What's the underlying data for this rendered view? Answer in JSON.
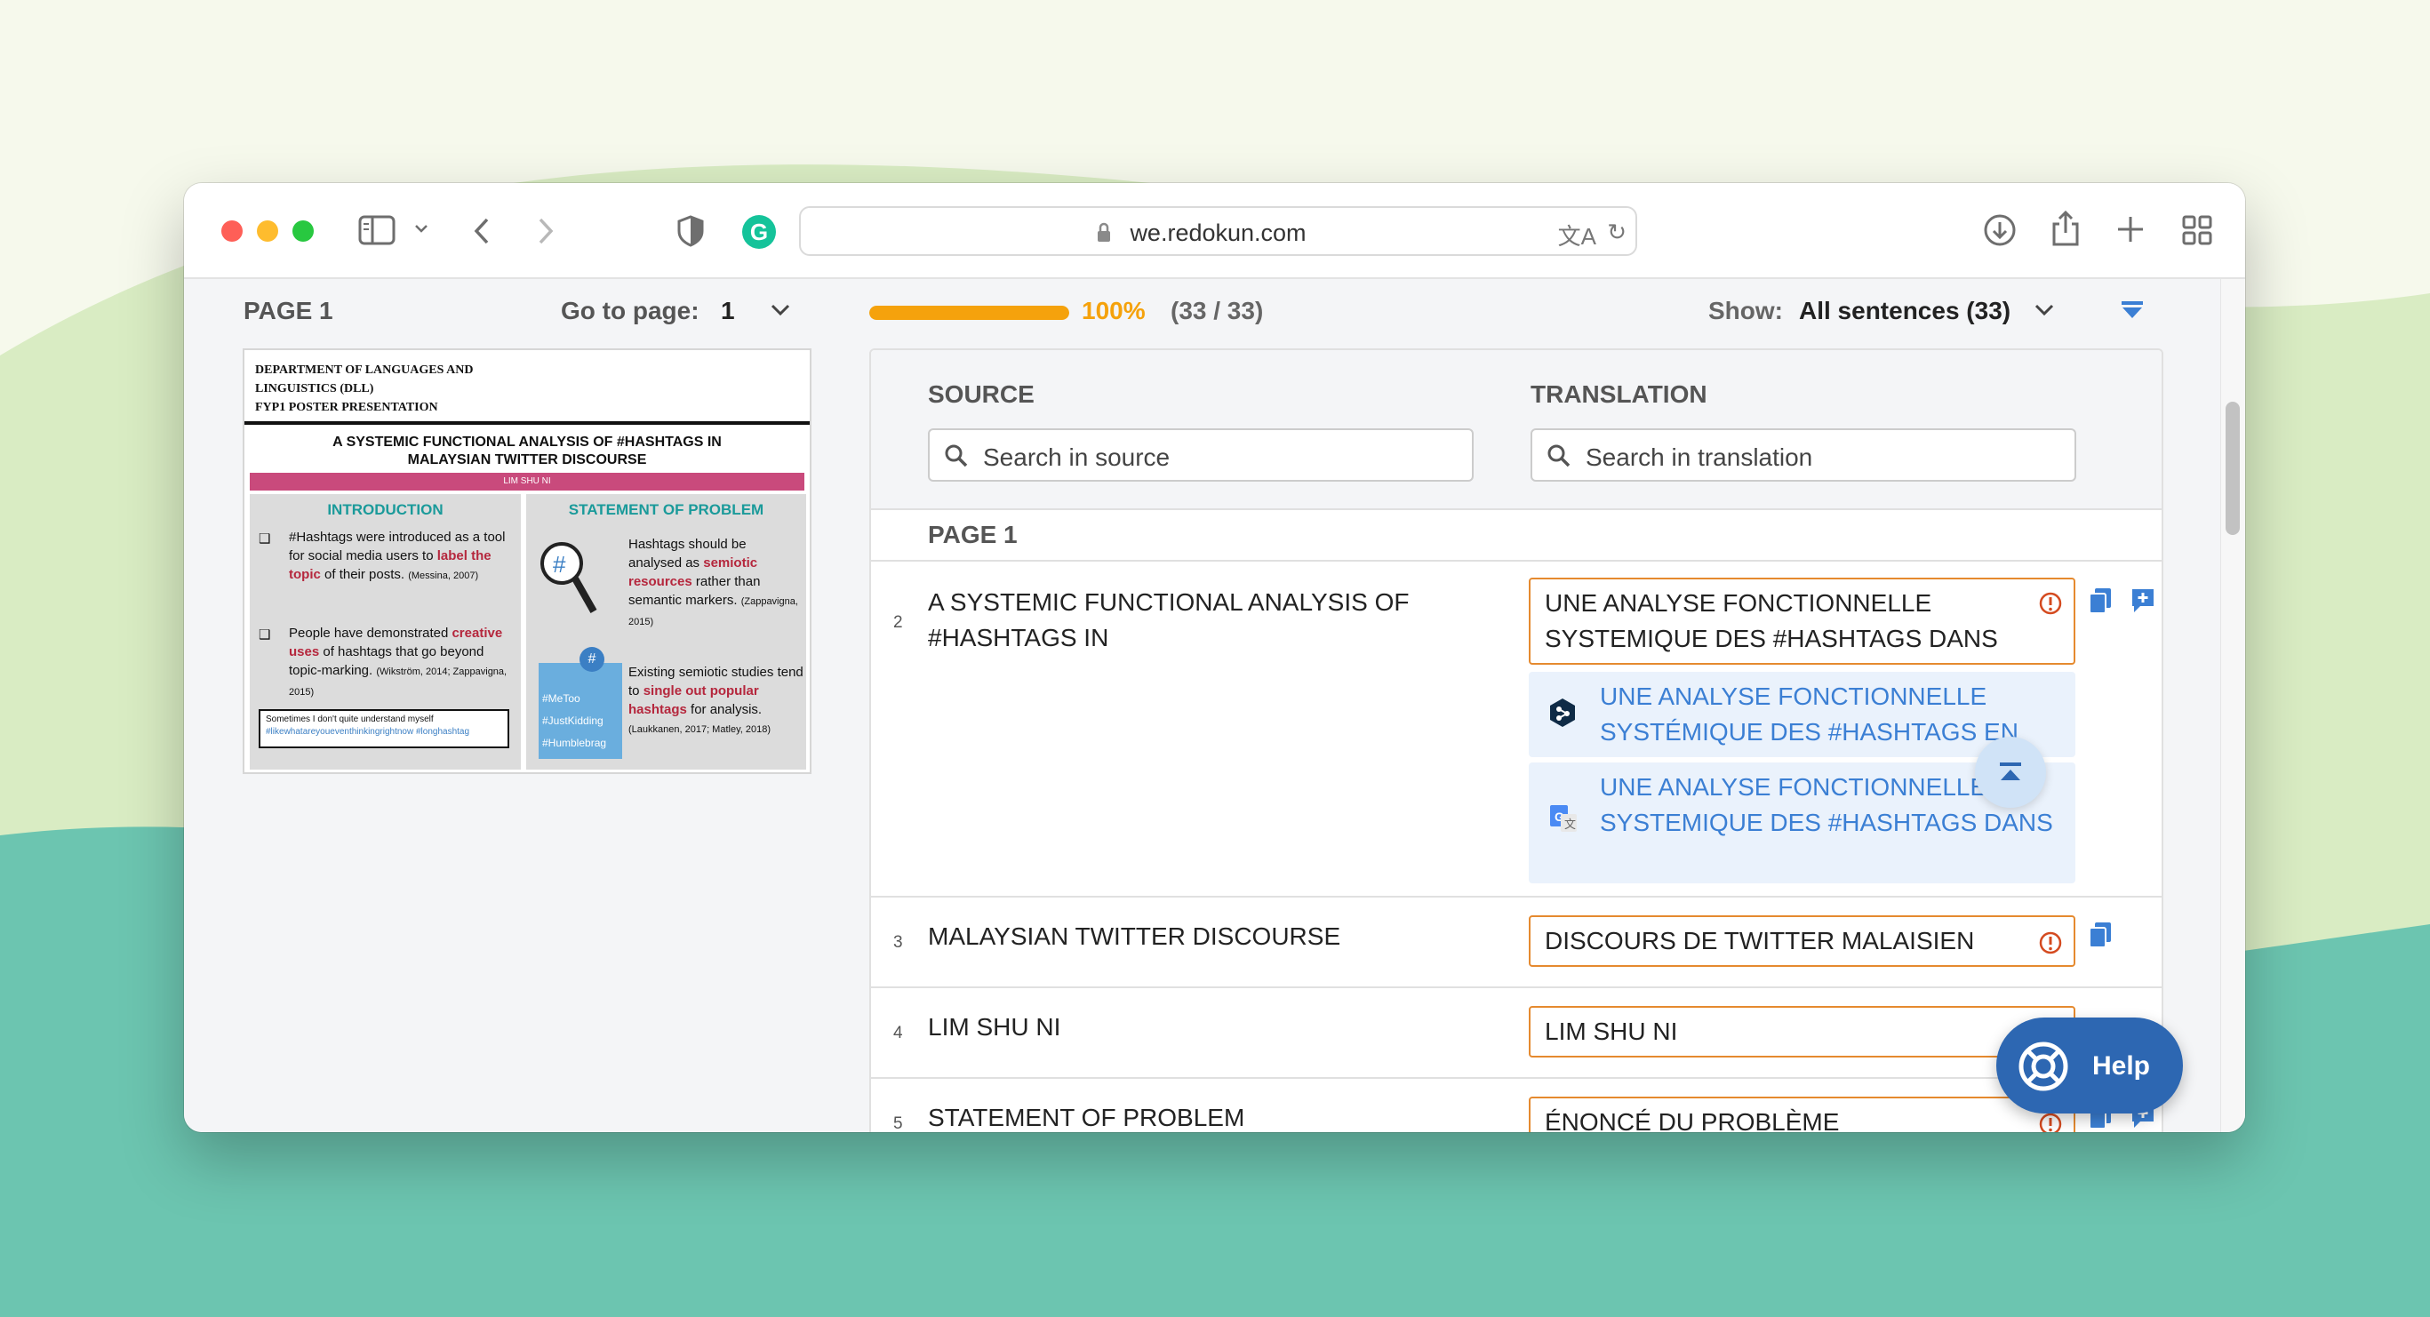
{
  "browser": {
    "url": "we.redokun.com"
  },
  "toolbar": {
    "page_label": "PAGE 1",
    "goto_label": "Go to page:",
    "goto_value": "1",
    "progress_percent": "100%",
    "progress_count": "(33 / 33)",
    "progress_fraction": 1.0,
    "show_label": "Show:",
    "show_value": "All sentences (33)"
  },
  "poster": {
    "dept_line1": "DEPARTMENT OF LANGUAGES AND",
    "dept_line2": "LINGUISTICS (DLL)",
    "dept_line3": "FYP1 POSTER PRESENTATION",
    "title_line1": "A SYSTEMIC FUNCTIONAL ANALYSIS OF #HASHTAGS IN",
    "title_line2": "MALAYSIAN TWITTER DISCOURSE",
    "author": "LIM SHU NI",
    "intro_heading": "INTRODUCTION",
    "intro_p1_a": "#Hashtags were introduced as a tool for social media users to",
    "intro_p1_hl": "label the topic",
    "intro_p1_b": "of their posts.",
    "intro_p1_cite": "(Messina, 2007)",
    "intro_p2_a": "People have demonstrated",
    "intro_p2_hl": "creative uses",
    "intro_p2_b": "of hashtags that go beyond topic-marking.",
    "intro_p2_cite": "(Wikström, 2014; Zappavigna, 2015)",
    "quote_line": "Sometimes I don't quite understand myself",
    "quote_tags": "#likewhatareyoueventhinkingrightnow #longhashtag",
    "problem_heading": "STATEMENT OF PROBLEM",
    "problem_p1_a": "Hashtags should be analysed as",
    "problem_p1_hl": "semiotic resources",
    "problem_p1_b": "rather than semantic markers.",
    "problem_p1_cite": "(Zappavigna, 2015)",
    "problem_p2_a": "Existing semiotic studies tend to",
    "problem_p2_hl": "single out popular hashtags",
    "problem_p2_b": "for analysis.",
    "problem_p2_cite": "(Laukkanen, 2017; Matley, 2018)",
    "tag1": "#MeToo",
    "tag2": "#JustKidding",
    "tag3": "#Humblebrag"
  },
  "table": {
    "source_title": "SOURCE",
    "translation_title": "TRANSLATION",
    "source_search_placeholder": "Search in source",
    "translation_search_placeholder": "Search in translation",
    "section_label": "PAGE 1",
    "rows": [
      {
        "num": "2",
        "source": "A SYSTEMIC FUNCTIONAL ANALYSIS OF #HASHTAGS IN",
        "translation": "UNE ANALYSE FONCTIONNELLE SYSTEMIQUE DES #HASHTAGS DANS",
        "suggestions": [
          {
            "engine_icon": "deepl-icon",
            "text": "UNE ANALYSE FONCTIONNELLE SYSTÉMIQUE DES #HASHTAGS EN"
          },
          {
            "engine_icon": "google-translate-icon",
            "text": "UNE ANALYSE FONCTIONNELLE SYSTEMIQUE DES #HASHTAGS DANS"
          }
        ]
      },
      {
        "num": "3",
        "source": "MALAYSIAN TWITTER DISCOURSE",
        "translation": "DISCOURS DE TWITTER MALAISIEN"
      },
      {
        "num": "4",
        "source": "LIM SHU NI",
        "translation": "LIM SHU NI"
      },
      {
        "num": "5",
        "source": "STATEMENT OF PROBLEM",
        "translation": "ÉNONCÉ DU PROBLÈME"
      }
    ]
  },
  "help": {
    "label": "Help"
  },
  "colors": {
    "accent": "#f5a20c",
    "warning": "#e58a2f",
    "link": "#3b7fd4",
    "help_bg": "#2d67b2"
  }
}
